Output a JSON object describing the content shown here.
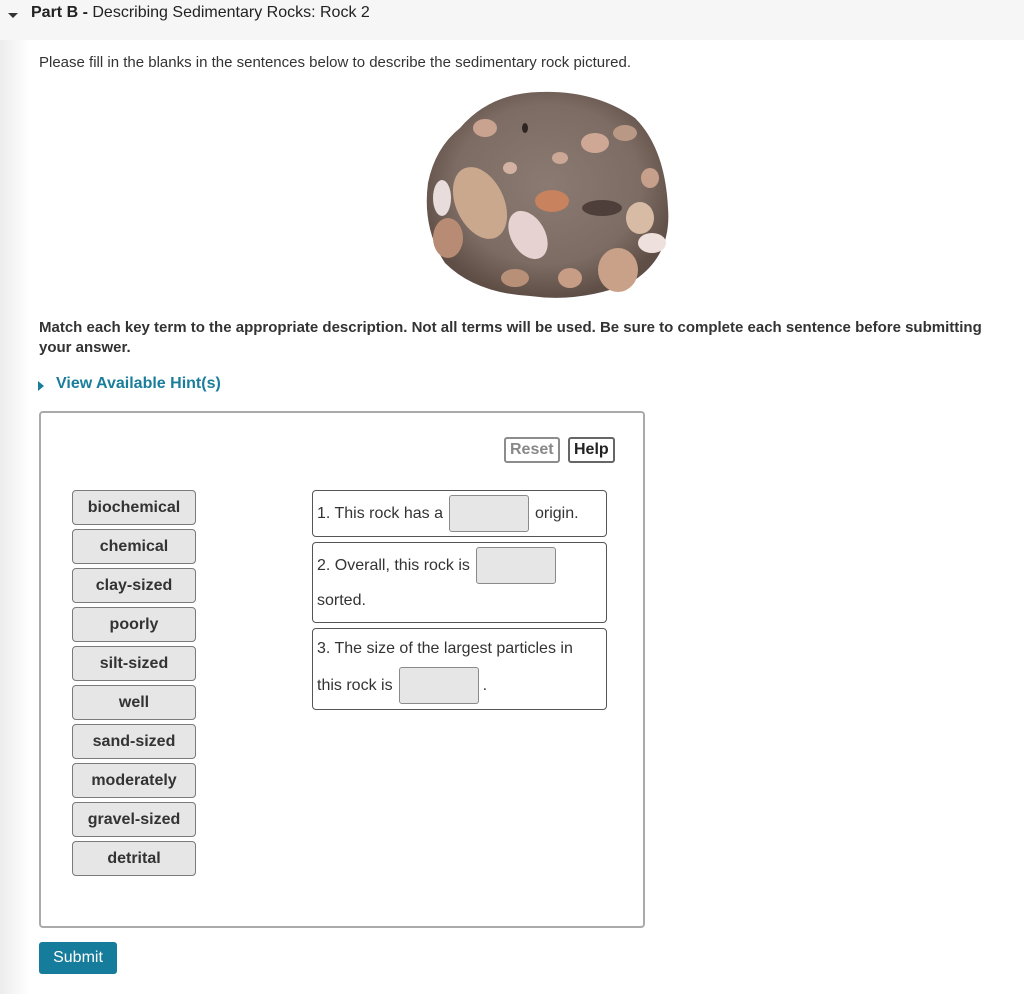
{
  "part": {
    "label": "Part B -",
    "title": "Describing Sedimentary Rocks: Rock 2"
  },
  "intro": "Please fill in the blanks in the sentences below to describe the sedimentary rock pictured.",
  "image": {
    "alt": "sedimentary rock with rounded gravel clasts in a sandy matrix"
  },
  "instructions": "Match each key term to the appropriate description. Not all terms will be used. Be sure to complete each sentence before submitting your answer.",
  "hint_link": "View Available Hint(s)",
  "toolbar": {
    "reset": "Reset",
    "help": "Help"
  },
  "terms": [
    "biochemical",
    "chemical",
    "clay-sized",
    "poorly",
    "silt-sized",
    "well",
    "sand-sized",
    "moderately",
    "gravel-sized",
    "detrital"
  ],
  "sentences": [
    {
      "before": "1. This rock has a",
      "after": "origin.",
      "value": ""
    },
    {
      "before": "2. Overall, this rock is",
      "after": "sorted.",
      "value": ""
    },
    {
      "before_line1": "3. The size of the largest particles in",
      "before_line2": "this rock is",
      "after": ".",
      "value": ""
    }
  ],
  "submit": "Submit"
}
